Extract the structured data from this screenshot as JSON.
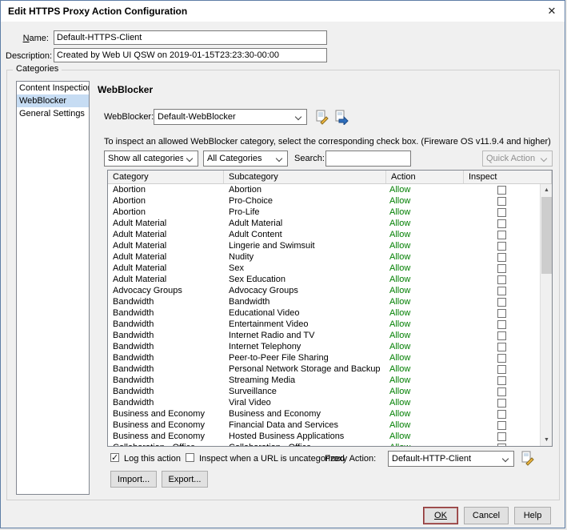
{
  "dialog": {
    "title": "Edit HTTPS Proxy Action Configuration",
    "close_glyph": "✕"
  },
  "fields": {
    "name_label_accel": "N",
    "name_label_rest": "ame:",
    "name_value": "Default-HTTPS-Client",
    "description_label": "Description:",
    "description_value": "Created by Web UI QSW on 2019-01-15T23:23:30-00:00"
  },
  "categories_box": {
    "label": "Categories",
    "items": [
      "Content Inspection",
      "WebBlocker",
      "General Settings"
    ],
    "selected": "WebBlocker"
  },
  "webblocker": {
    "heading": "WebBlocker",
    "profile_label": "WebBlocker:",
    "profile_value": "Default-WebBlocker",
    "instruction": "To inspect an allowed WebBlocker category, select the corresponding check box. (Fireware OS v11.9.4 and higher)",
    "category_filter_value": "Show all categories",
    "subcategory_filter_value": "All Categories",
    "search_label": "Search:",
    "search_value": "",
    "quick_action_label": "Quick Action",
    "action_color": "#007f00",
    "table": {
      "headers": [
        "Category",
        "Subcategory",
        "Action",
        "Inspect"
      ],
      "rows": [
        {
          "category": "Abortion",
          "subcategory": "Abortion",
          "action": "Allow",
          "inspect": false
        },
        {
          "category": "Abortion",
          "subcategory": "Pro-Choice",
          "action": "Allow",
          "inspect": false
        },
        {
          "category": "Abortion",
          "subcategory": "Pro-Life",
          "action": "Allow",
          "inspect": false
        },
        {
          "category": "Adult Material",
          "subcategory": "Adult Material",
          "action": "Allow",
          "inspect": false
        },
        {
          "category": "Adult Material",
          "subcategory": "Adult Content",
          "action": "Allow",
          "inspect": false
        },
        {
          "category": "Adult Material",
          "subcategory": "Lingerie and Swimsuit",
          "action": "Allow",
          "inspect": false
        },
        {
          "category": "Adult Material",
          "subcategory": "Nudity",
          "action": "Allow",
          "inspect": false
        },
        {
          "category": "Adult Material",
          "subcategory": "Sex",
          "action": "Allow",
          "inspect": false
        },
        {
          "category": "Adult Material",
          "subcategory": "Sex Education",
          "action": "Allow",
          "inspect": false
        },
        {
          "category": "Advocacy Groups",
          "subcategory": "Advocacy Groups",
          "action": "Allow",
          "inspect": false
        },
        {
          "category": "Bandwidth",
          "subcategory": "Bandwidth",
          "action": "Allow",
          "inspect": false
        },
        {
          "category": "Bandwidth",
          "subcategory": "Educational Video",
          "action": "Allow",
          "inspect": false
        },
        {
          "category": "Bandwidth",
          "subcategory": "Entertainment Video",
          "action": "Allow",
          "inspect": false
        },
        {
          "category": "Bandwidth",
          "subcategory": "Internet Radio and TV",
          "action": "Allow",
          "inspect": false
        },
        {
          "category": "Bandwidth",
          "subcategory": "Internet Telephony",
          "action": "Allow",
          "inspect": false
        },
        {
          "category": "Bandwidth",
          "subcategory": "Peer-to-Peer File Sharing",
          "action": "Allow",
          "inspect": false
        },
        {
          "category": "Bandwidth",
          "subcategory": "Personal Network Storage and Backup",
          "action": "Allow",
          "inspect": false
        },
        {
          "category": "Bandwidth",
          "subcategory": "Streaming Media",
          "action": "Allow",
          "inspect": false
        },
        {
          "category": "Bandwidth",
          "subcategory": "Surveillance",
          "action": "Allow",
          "inspect": false
        },
        {
          "category": "Bandwidth",
          "subcategory": "Viral Video",
          "action": "Allow",
          "inspect": false
        },
        {
          "category": "Business and Economy",
          "subcategory": "Business and Economy",
          "action": "Allow",
          "inspect": false
        },
        {
          "category": "Business and Economy",
          "subcategory": "Financial Data and Services",
          "action": "Allow",
          "inspect": false
        },
        {
          "category": "Business and Economy",
          "subcategory": "Hosted Business Applications",
          "action": "Allow",
          "inspect": false
        },
        {
          "category": "Collaboration - Office",
          "subcategory": "Collaboration - Office",
          "action": "Allow",
          "inspect": false
        }
      ]
    },
    "log_action_label": "Log this action",
    "log_action_checked": true,
    "inspect_uncategorized_label": "Inspect when a URL is uncategorized",
    "inspect_uncategorized_checked": false,
    "proxy_action_label": "Proxy Action:",
    "proxy_action_value": "Default-HTTP-Client",
    "import_label": "Import...",
    "export_label": "Export..."
  },
  "footer": {
    "ok_label": "OK",
    "cancel_label": "Cancel",
    "help_label": "Help"
  }
}
